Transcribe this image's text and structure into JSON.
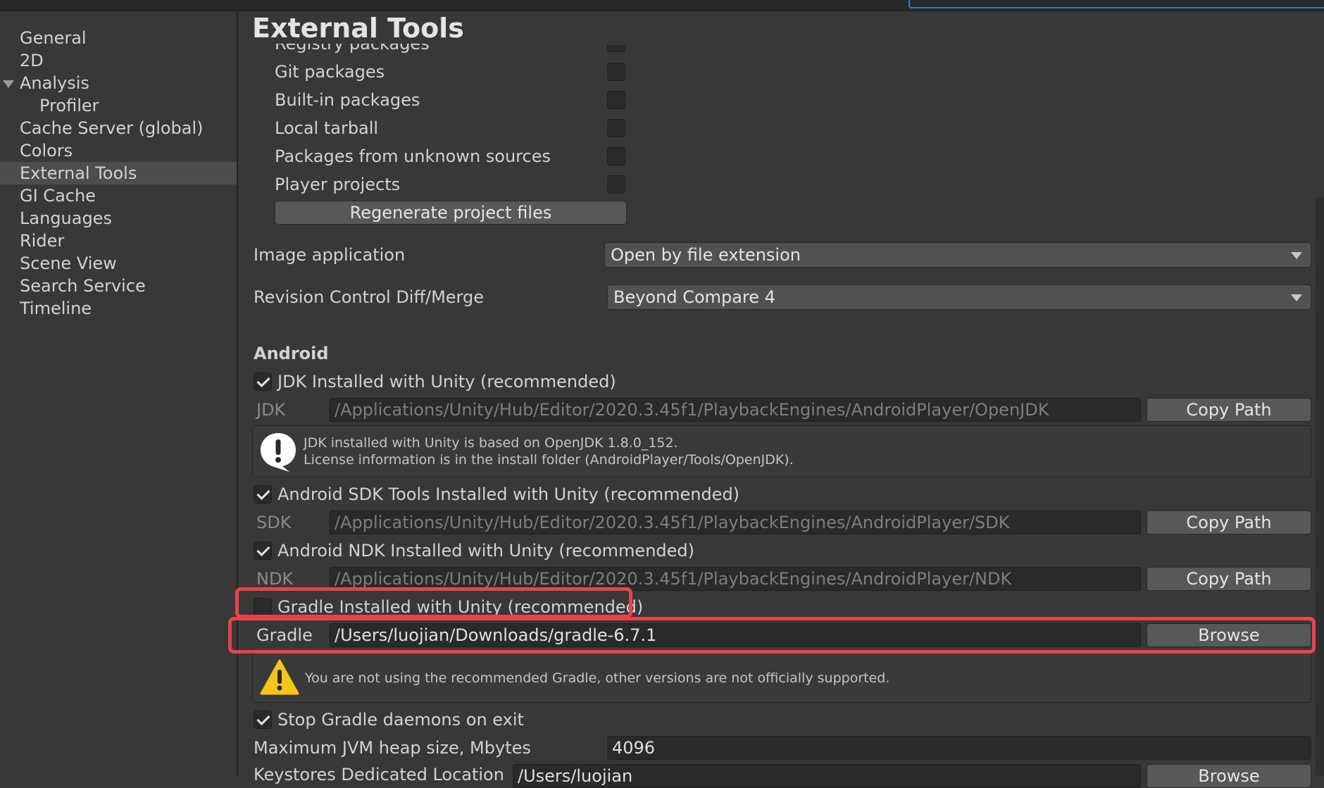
{
  "window": {
    "title": "External Tools"
  },
  "sidebar": {
    "items": [
      {
        "label": "General"
      },
      {
        "label": "2D"
      },
      {
        "label": "Analysis"
      },
      {
        "label": "Profiler"
      },
      {
        "label": "Cache Server (global)"
      },
      {
        "label": "Colors"
      },
      {
        "label": "External Tools",
        "selected": true
      },
      {
        "label": "GI Cache"
      },
      {
        "label": "Languages"
      },
      {
        "label": "Rider"
      },
      {
        "label": "Scene View"
      },
      {
        "label": "Search Service"
      },
      {
        "label": "Timeline"
      }
    ]
  },
  "packages": {
    "partial_label": "Registry packages",
    "items": [
      {
        "label": "Git packages",
        "checked": false
      },
      {
        "label": "Built-in packages",
        "checked": false
      },
      {
        "label": "Local tarball",
        "checked": false
      },
      {
        "label": "Packages from unknown sources",
        "checked": false
      },
      {
        "label": "Player projects",
        "checked": false
      }
    ],
    "regenerate_label": "Regenerate project files"
  },
  "image_application": {
    "label": "Image application",
    "value": "Open by file extension"
  },
  "revision_control": {
    "label": "Revision Control Diff/Merge",
    "value": "Beyond Compare 4"
  },
  "android": {
    "heading": "Android",
    "jdk": {
      "checkbox_label": "JDK Installed with Unity (recommended)",
      "checked": true,
      "field_label": "JDK",
      "path": "/Applications/Unity/Hub/Editor/2020.3.45f1/PlaybackEngines/AndroidPlayer/OpenJDK",
      "button": "Copy Path",
      "help_line1": "JDK installed with Unity is based on OpenJDK 1.8.0_152.",
      "help_line2": "License information is in the install folder (AndroidPlayer/Tools/OpenJDK)."
    },
    "sdk": {
      "checkbox_label": "Android SDK Tools Installed with Unity (recommended)",
      "checked": true,
      "field_label": "SDK",
      "path": "/Applications/Unity/Hub/Editor/2020.3.45f1/PlaybackEngines/AndroidPlayer/SDK",
      "button": "Copy Path"
    },
    "ndk": {
      "checkbox_label": "Android NDK Installed with Unity (recommended)",
      "checked": true,
      "field_label": "NDK",
      "path": "/Applications/Unity/Hub/Editor/2020.3.45f1/PlaybackEngines/AndroidPlayer/NDK",
      "button": "Copy Path"
    },
    "gradle": {
      "checkbox_label": "Gradle Installed with Unity (recommended)",
      "checked": false,
      "field_label": "Gradle",
      "path": "/Users/luojian/Downloads/gradle-6.7.1",
      "button": "Browse",
      "warning": "You are not using the recommended Gradle, other versions are not officially supported."
    },
    "stop_daemons": {
      "label": "Stop Gradle daemons on exit",
      "checked": true
    },
    "jvm_heap": {
      "label": "Maximum JVM heap size, Mbytes",
      "value": "4096"
    },
    "keystores": {
      "label": "Keystores Dedicated Location",
      "value": "/Users/luojian",
      "button": "Browse"
    }
  },
  "colors": {
    "highlight": "#e8434a",
    "warning": "#f5c518",
    "accent": "#3a79bb"
  }
}
